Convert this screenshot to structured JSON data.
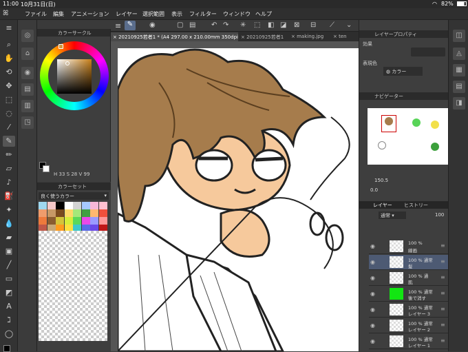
{
  "status": {
    "time": "11:00",
    "date": "10月31日(日)",
    "battery": "82%"
  },
  "menu": [
    "ファイル",
    "編集",
    "アニメーション",
    "レイヤー",
    "選択範囲",
    "表示",
    "フィルター",
    "ウィンドウ",
    "ヘルプ"
  ],
  "panels": {
    "color_circle": "カラーサークル",
    "color_set": "カラーセット",
    "color_set_name": "良く使うカラー",
    "hsv": {
      "h": "33",
      "s": "28",
      "v": "99"
    },
    "layer_property": "レイヤープロパティ",
    "effect_label": "効果",
    "display_color_label": "表現色",
    "display_color_value": "カラー",
    "navigator": "ナビゲーター",
    "zoom": "150.5",
    "rotation": "0.0",
    "layer_tab": "レイヤー",
    "history_tab": "ヒストリー",
    "blend_mode": "通常",
    "opacity": "100"
  },
  "tabs": [
    {
      "label": "20210925若者1 * (A4 297.00 x 210.00mm 350dpi 150.5%)",
      "active": true
    },
    {
      "label": "20210925若者1",
      "active": false
    },
    {
      "label": "making.jpg",
      "active": false
    },
    {
      "label": "ten",
      "active": false
    }
  ],
  "layers": [
    {
      "line1": "100 %",
      "line2": "線画",
      "selected": false,
      "green": false
    },
    {
      "line1": "100 % 通常",
      "line2": "髪",
      "selected": true,
      "green": false
    },
    {
      "line1": "100 % 通",
      "line2": "肌",
      "selected": false,
      "green": false
    },
    {
      "line1": "100 % 通常",
      "line2": "後で消す",
      "selected": false,
      "green": true
    },
    {
      "line1": "100 % 通常",
      "line2": "レイヤー 3",
      "selected": false,
      "green": false
    },
    {
      "line1": "100 % 通常",
      "line2": "レイヤー 2",
      "selected": false,
      "green": false
    },
    {
      "line1": "100 % 通常",
      "line2": "レイヤー 1",
      "selected": false,
      "green": false
    }
  ],
  "colors": {
    "main": "#b5884e",
    "skin": "#f6c99c",
    "hair": "#a67c4c",
    "selected_layer": "#4d5a73"
  }
}
